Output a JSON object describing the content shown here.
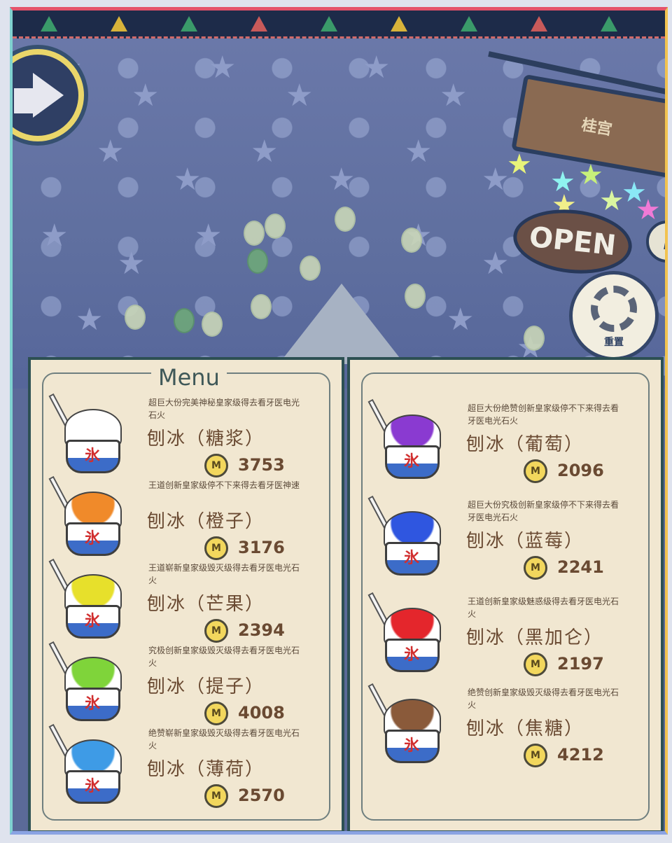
{
  "scene": {
    "sign_top": "桂宫",
    "open_sign": "OPEN",
    "info_icon": "i",
    "reset_label": "重置"
  },
  "menu": {
    "title": "Menu",
    "currency_icon": "M",
    "left_items": [
      {
        "desc": "超巨大份完美神秘皇家级得去看牙医电光石火",
        "name": "刨冰（糖浆）",
        "price": "3753",
        "color": "#ffffff"
      },
      {
        "desc": "王道创新皇家级停不下来得去看牙医神速",
        "name": "刨冰（橙子）",
        "price": "3176",
        "color": "#f08a2a"
      },
      {
        "desc": "王道崭新皇家级毁灭级得去看牙医电光石火",
        "name": "刨冰（芒果）",
        "price": "2394",
        "color": "#e7e02b"
      },
      {
        "desc": "究极创新皇家级毁灭级得去看牙医电光石火",
        "name": "刨冰（提子）",
        "price": "4008",
        "color": "#7fd43a"
      },
      {
        "desc": "绝赞崭新皇家级毁灭级得去看牙医电光石火",
        "name": "刨冰（薄荷）",
        "price": "2570",
        "color": "#3e9be6"
      }
    ],
    "right_items": [
      {
        "desc": "超巨大份绝赞创新皇家级停不下来得去看牙医电光石火",
        "name": "刨冰（葡萄）",
        "price": "2096",
        "color": "#8a3ad1"
      },
      {
        "desc": "超巨大份究极创新皇家级停不下来得去看牙医电光石火",
        "name": "刨冰（蓝莓）",
        "price": "2241",
        "color": "#2f56e0"
      },
      {
        "desc": "王道创新皇家级魅惑级得去看牙医电光石火",
        "name": "刨冰（黑加仑）",
        "price": "2197",
        "color": "#e4262c"
      },
      {
        "desc": "绝赞创新皇家级毁灭级得去看牙医电光石火",
        "name": "刨冰（焦糖）",
        "price": "4212",
        "color": "#8a5a3a"
      }
    ]
  }
}
